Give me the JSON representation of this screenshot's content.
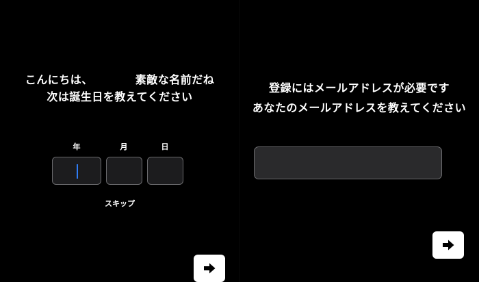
{
  "birthday_screen": {
    "greeting_line1_prefix": "こんにちは、",
    "greeting_line1_suffix": "素敵な名前だね",
    "greeting_line2": "次は誕生日を教えてください",
    "labels": {
      "year": "年",
      "month": "月",
      "day": "日"
    },
    "values": {
      "year": "",
      "month": "",
      "day": ""
    },
    "skip_label": "スキップ",
    "next_icon": "arrow-right-icon"
  },
  "email_screen": {
    "title_line1": "登録にはメールアドレスが必要です",
    "title_line2": "あなたのメールアドレスを教えてください",
    "email_value": "",
    "next_icon": "arrow-right-icon"
  },
  "colors": {
    "background": "#000000",
    "text": "#ffffff",
    "field_bg": "#1c1c1e",
    "field_border": "#6b6b6e",
    "caret": "#2f7df6",
    "button_bg": "#ffffff",
    "icon": "#000000"
  }
}
